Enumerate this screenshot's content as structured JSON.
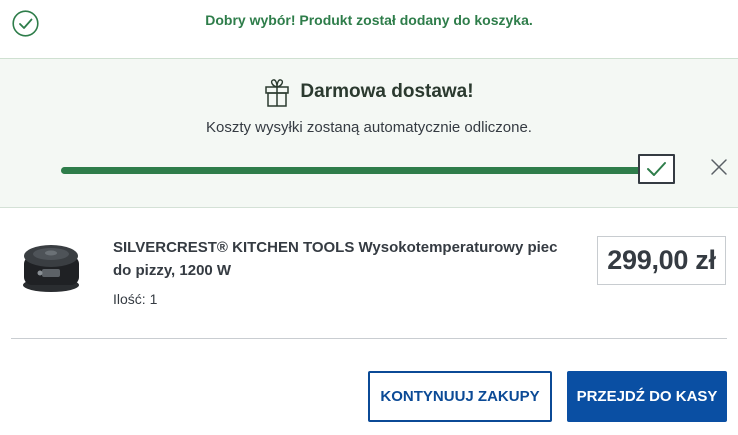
{
  "notification": {
    "message": "Dobry wybór! Produkt został dodany do koszyka."
  },
  "shipping": {
    "title": "Darmowa dostawa!",
    "subtitle": "Koszty wysyłki zostaną automatycznie odliczone.",
    "progress_fraction": 1.0
  },
  "product": {
    "name": "SILVERCREST® KITCHEN TOOLS Wysokotemperaturowy piec do pizzy, 1200 W",
    "quantity_label": "Ilość:",
    "quantity_value": "1",
    "price": "299,00 zł"
  },
  "actions": {
    "continue_label": "KONTYNUUJ ZAKUPY",
    "checkout_label": "PRZEJDŹ DO KASY"
  },
  "colors": {
    "success_green": "#2e7d4a",
    "primary_blue": "#0a4fa3"
  }
}
